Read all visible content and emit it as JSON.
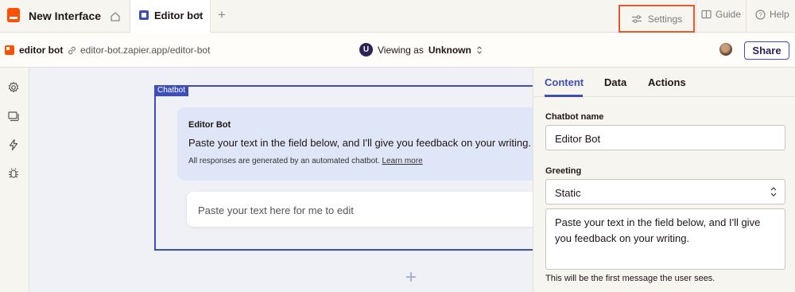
{
  "topbar": {
    "app_title": "New Interface",
    "tab_label": "Editor bot",
    "tab_close": "×",
    "add_tab": "+",
    "settings_label": "Settings",
    "guide_label": "Guide",
    "help_label": "Help"
  },
  "subbar": {
    "title": "editor bot",
    "url": "editor-bot.zapier.app/editor-bot",
    "viewing_prefix": "Viewing as",
    "viewing_user": "Unknown",
    "user_initial": "U",
    "share_label": "Share"
  },
  "canvas": {
    "frame_tag": "Chatbot",
    "bot_name": "Editor Bot",
    "greeting_message": "Paste your text in the field below, and I'll give you feedback on your writing.",
    "disclaimer": "All responses are generated by an automated chatbot.",
    "learn_more": "Learn more",
    "input_placeholder": "Paste your text here for me to edit",
    "add_section": "+"
  },
  "panel": {
    "tabs": [
      {
        "label": "Content",
        "active": true
      },
      {
        "label": "Data",
        "active": false
      },
      {
        "label": "Actions",
        "active": false
      }
    ],
    "chatbot_name_label": "Chatbot name",
    "chatbot_name_value": "Editor Bot",
    "greeting_label": "Greeting",
    "greeting_type": "Static",
    "greeting_text": "Paste your text in the field below, and I'll give you feedback on your writing.",
    "greeting_hint": "This will be the first message the user sees."
  },
  "colors": {
    "brand_orange": "#ff4f00",
    "accent_blue": "#3d4eb8",
    "highlight_border": "#e8582a"
  }
}
